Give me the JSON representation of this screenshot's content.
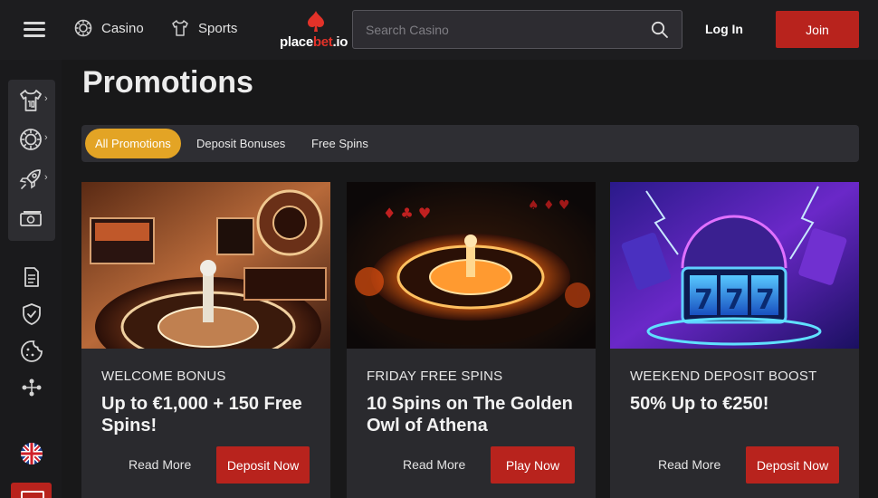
{
  "header": {
    "nav": [
      {
        "label": "Casino",
        "icon": "casino-chip-icon"
      },
      {
        "label": "Sports",
        "icon": "jersey-icon"
      }
    ],
    "logo": {
      "text_main": "place",
      "text_accent": "bet",
      "text_suffix": ".io"
    },
    "search": {
      "placeholder": "Search Casino",
      "value": ""
    },
    "login_label": "Log In",
    "join_label": "Join"
  },
  "sidebar": {
    "group_icons": [
      "jersey-icon",
      "casino-chip-icon",
      "rocket-icon",
      "cash-icon"
    ],
    "lower_icons": [
      "document-icon",
      "shield-check-icon",
      "cookie-icon",
      "soccer-field-icon"
    ],
    "language_icon": "uk-flag-icon"
  },
  "page": {
    "title": "Promotions"
  },
  "tabs": [
    {
      "label": "All Promotions",
      "active": true
    },
    {
      "label": "Deposit Bonuses",
      "active": false
    },
    {
      "label": "Free Spins",
      "active": false
    }
  ],
  "cards": [
    {
      "kicker": "WELCOME BONUS",
      "headline": "Up to €1,000 + 150 Free Spins!",
      "read_more": "Read More",
      "cta": "Deposit Now",
      "image": "roulette-casino-illustration"
    },
    {
      "kicker": "FRIDAY FREE SPINS",
      "headline": "10 Spins on The Golden Owl of Athena",
      "read_more": "Read More",
      "cta": "Play Now",
      "image": "glowing-roulette-wheel-illustration"
    },
    {
      "kicker": "WEEKEND DEPOSIT BOOST",
      "headline": "50% Up to €250!",
      "read_more": "Read More",
      "cta": "Deposit Now",
      "image": "slot-777-neon-illustration"
    }
  ],
  "colors": {
    "accent_red": "#b8231d",
    "accent_gold": "#e3a425",
    "background": "#181819",
    "card": "#2a2a2e"
  }
}
